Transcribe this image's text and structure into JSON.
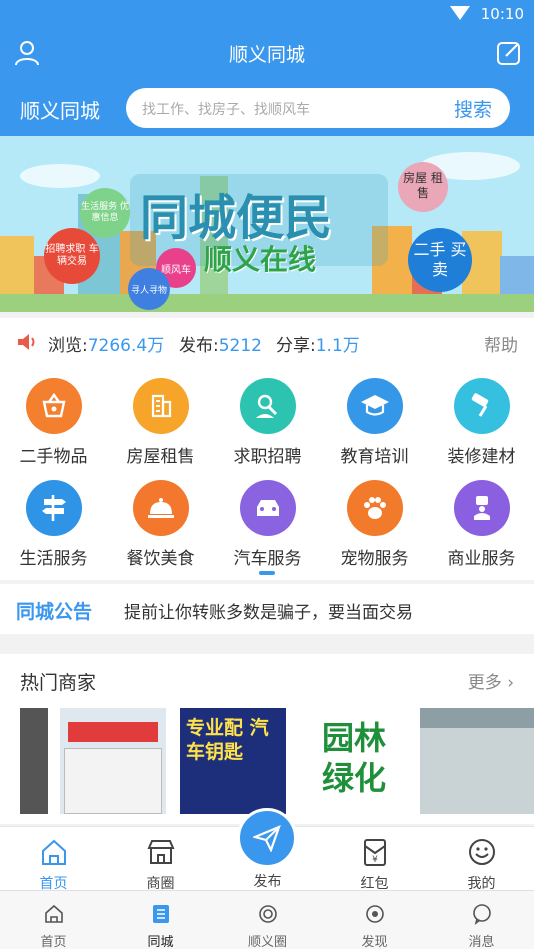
{
  "status": {
    "time": "10:10"
  },
  "appbar": {
    "title": "顺义同城"
  },
  "search": {
    "brand": "顺义同城",
    "placeholder": "找工作、找房子、找顺风车",
    "button": "搜索"
  },
  "banner": {
    "headline": "同城便民",
    "subline": "顺义在线",
    "tags": [
      "生活服务 优惠信息",
      "招聘求职 车辆交易",
      "顺风车",
      "寻人寻物",
      "房屋 租售",
      "二手 买卖"
    ]
  },
  "stats": {
    "views_label": "浏览:",
    "views": "7266.4万",
    "posts_label": "发布:",
    "posts": "5212",
    "shares_label": "分享:",
    "shares": "1.1万",
    "help": "帮助"
  },
  "categories": [
    {
      "label": "二手物品",
      "icon": "basket-icon",
      "color": "#f37f2f"
    },
    {
      "label": "房屋租售",
      "icon": "building-icon",
      "color": "#f7a42b"
    },
    {
      "label": "求职招聘",
      "icon": "job-search-icon",
      "color": "#2cc4b0"
    },
    {
      "label": "教育培训",
      "icon": "graduation-cap-icon",
      "color": "#3597e8"
    },
    {
      "label": "装修建材",
      "icon": "paint-roller-icon",
      "color": "#36c0e0"
    },
    {
      "label": "生活服务",
      "icon": "signpost-icon",
      "color": "#2f93e6"
    },
    {
      "label": "餐饮美食",
      "icon": "food-cloche-icon",
      "color": "#f3772d"
    },
    {
      "label": "汽车服务",
      "icon": "car-icon",
      "color": "#8a63e0"
    },
    {
      "label": "宠物服务",
      "icon": "paw-icon",
      "color": "#f27a2b"
    },
    {
      "label": "商业服务",
      "icon": "meeting-icon",
      "color": "#8a5fe0"
    }
  ],
  "notice": {
    "tag": "同城公告",
    "text": "提前让你转账多数是骗子，要当面交易"
  },
  "merchants": {
    "title": "热门商家",
    "more": "更多",
    "items": [
      {
        "text": ""
      },
      {
        "text": ""
      },
      {
        "text": "专业配 汽车钥匙"
      },
      {
        "text": "园林 绿化"
      },
      {
        "text": ""
      }
    ]
  },
  "tabs_top": [
    {
      "label": "首页",
      "icon": "home-icon"
    },
    {
      "label": "商圈",
      "icon": "store-icon"
    },
    {
      "label": "发布",
      "icon": "paper-plane-icon"
    },
    {
      "label": "红包",
      "icon": "red-envelope-icon"
    },
    {
      "label": "我的",
      "icon": "smile-icon"
    }
  ],
  "tabs_bottom": [
    {
      "label": "首页",
      "icon": "home-icon"
    },
    {
      "label": "同城",
      "icon": "list-icon"
    },
    {
      "label": "顺义圈",
      "icon": "circle-icon"
    },
    {
      "label": "发现",
      "icon": "compass-icon"
    },
    {
      "label": "消息",
      "icon": "message-icon"
    }
  ],
  "colors": {
    "primary": "#3a97ee"
  }
}
